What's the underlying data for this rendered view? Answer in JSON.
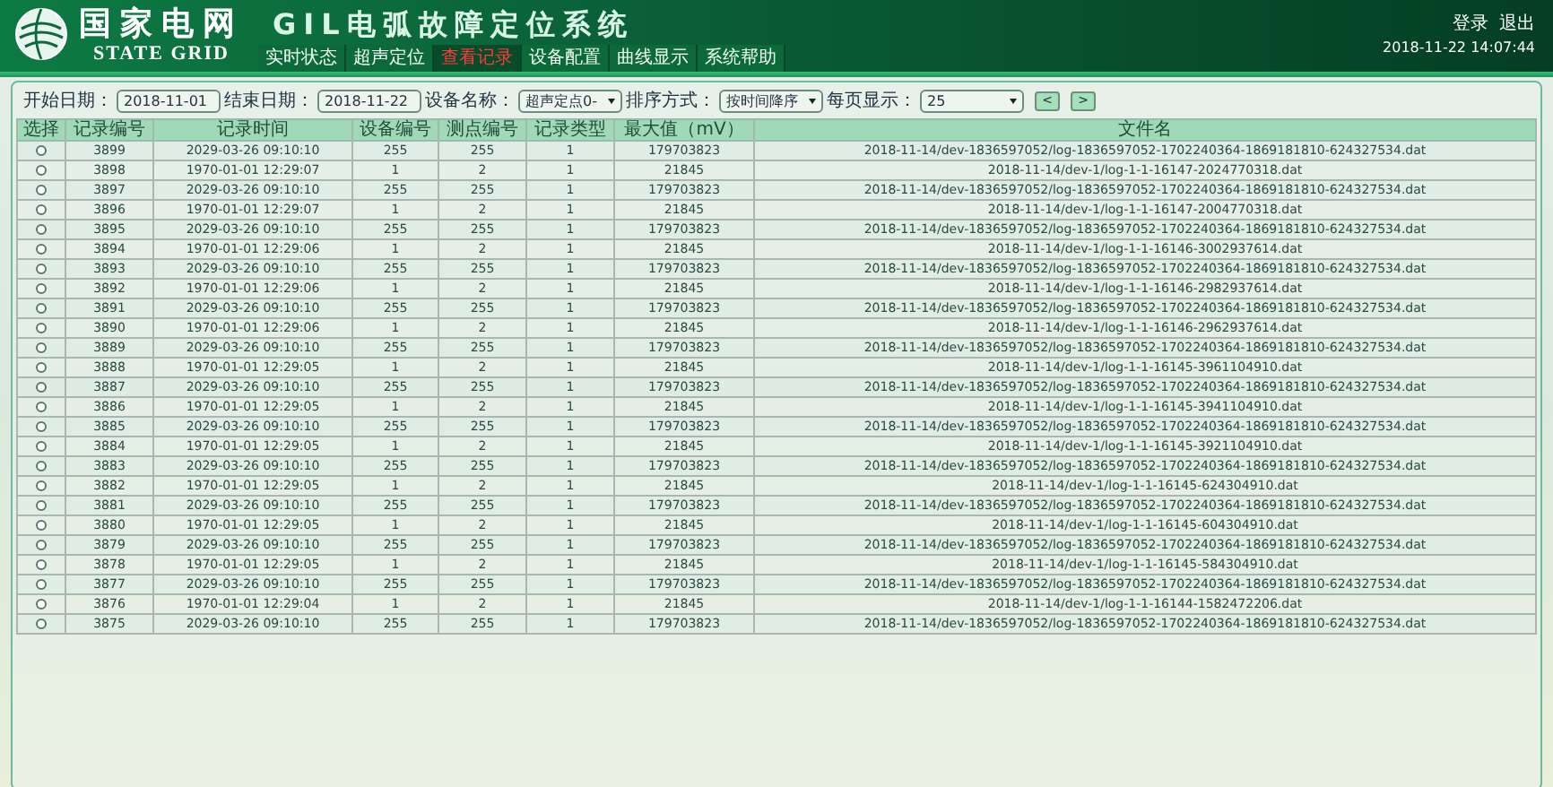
{
  "header": {
    "logo_cn": "国家电网",
    "logo_en": "STATE GRID",
    "title": "GIL电弧故障定位系统",
    "user_links": [
      "登录",
      "退出"
    ],
    "datetime": "2018-11-22 14:07:44"
  },
  "nav": [
    {
      "label": "实时状态",
      "selected": false
    },
    {
      "label": "超声定位",
      "selected": false
    },
    {
      "label": "查看记录",
      "selected": true
    },
    {
      "label": "设备配置",
      "selected": false
    },
    {
      "label": "曲线显示",
      "selected": false
    },
    {
      "label": "系统帮助",
      "selected": false
    }
  ],
  "filters": [
    {
      "kind": "input",
      "label": "开始日期：",
      "value": "2018-11-01"
    },
    {
      "kind": "input",
      "label": "结束日期：",
      "value": "2018-11-22"
    },
    {
      "kind": "select",
      "label": "设备名称：",
      "value": "超声定点0-"
    },
    {
      "kind": "select",
      "label": "排序方式：",
      "value": "按时间降序"
    },
    {
      "kind": "select",
      "label": "每页显示：",
      "value": "25"
    }
  ],
  "pager_buttons": [
    "<",
    ">"
  ],
  "table": {
    "columns": [
      "选择",
      "记录编号",
      "记录时间",
      "设备编号",
      "测点编号",
      "记录类型",
      "最大值（mV）",
      "文件名"
    ],
    "rows": [
      {
        "selected": false,
        "record_no": "3899",
        "record_time": "2029-03-26 09:10:10",
        "device_no": "255",
        "point_no": "255",
        "record_type": "1",
        "max_value": "179703823",
        "file_name": "2018-11-14/dev-1836597052/log-1836597052-1702240364-1869181810-624327534.dat"
      },
      {
        "selected": false,
        "record_no": "3898",
        "record_time": "1970-01-01 12:29:07",
        "device_no": "1",
        "point_no": "2",
        "record_type": "1",
        "max_value": "21845",
        "file_name": "2018-11-14/dev-1/log-1-1-16147-2024770318.dat"
      },
      {
        "selected": false,
        "record_no": "3897",
        "record_time": "2029-03-26 09:10:10",
        "device_no": "255",
        "point_no": "255",
        "record_type": "1",
        "max_value": "179703823",
        "file_name": "2018-11-14/dev-1836597052/log-1836597052-1702240364-1869181810-624327534.dat"
      },
      {
        "selected": false,
        "record_no": "3896",
        "record_time": "1970-01-01 12:29:07",
        "device_no": "1",
        "point_no": "2",
        "record_type": "1",
        "max_value": "21845",
        "file_name": "2018-11-14/dev-1/log-1-1-16147-2004770318.dat"
      },
      {
        "selected": false,
        "record_no": "3895",
        "record_time": "2029-03-26 09:10:10",
        "device_no": "255",
        "point_no": "255",
        "record_type": "1",
        "max_value": "179703823",
        "file_name": "2018-11-14/dev-1836597052/log-1836597052-1702240364-1869181810-624327534.dat"
      },
      {
        "selected": false,
        "record_no": "3894",
        "record_time": "1970-01-01 12:29:06",
        "device_no": "1",
        "point_no": "2",
        "record_type": "1",
        "max_value": "21845",
        "file_name": "2018-11-14/dev-1/log-1-1-16146-3002937614.dat"
      },
      {
        "selected": false,
        "record_no": "3893",
        "record_time": "2029-03-26 09:10:10",
        "device_no": "255",
        "point_no": "255",
        "record_type": "1",
        "max_value": "179703823",
        "file_name": "2018-11-14/dev-1836597052/log-1836597052-1702240364-1869181810-624327534.dat"
      },
      {
        "selected": false,
        "record_no": "3892",
        "record_time": "1970-01-01 12:29:06",
        "device_no": "1",
        "point_no": "2",
        "record_type": "1",
        "max_value": "21845",
        "file_name": "2018-11-14/dev-1/log-1-1-16146-2982937614.dat"
      },
      {
        "selected": false,
        "record_no": "3891",
        "record_time": "2029-03-26 09:10:10",
        "device_no": "255",
        "point_no": "255",
        "record_type": "1",
        "max_value": "179703823",
        "file_name": "2018-11-14/dev-1836597052/log-1836597052-1702240364-1869181810-624327534.dat"
      },
      {
        "selected": false,
        "record_no": "3890",
        "record_time": "1970-01-01 12:29:06",
        "device_no": "1",
        "point_no": "2",
        "record_type": "1",
        "max_value": "21845",
        "file_name": "2018-11-14/dev-1/log-1-1-16146-2962937614.dat"
      },
      {
        "selected": false,
        "record_no": "3889",
        "record_time": "2029-03-26 09:10:10",
        "device_no": "255",
        "point_no": "255",
        "record_type": "1",
        "max_value": "179703823",
        "file_name": "2018-11-14/dev-1836597052/log-1836597052-1702240364-1869181810-624327534.dat"
      },
      {
        "selected": false,
        "record_no": "3888",
        "record_time": "1970-01-01 12:29:05",
        "device_no": "1",
        "point_no": "2",
        "record_type": "1",
        "max_value": "21845",
        "file_name": "2018-11-14/dev-1/log-1-1-16145-3961104910.dat"
      },
      {
        "selected": false,
        "record_no": "3887",
        "record_time": "2029-03-26 09:10:10",
        "device_no": "255",
        "point_no": "255",
        "record_type": "1",
        "max_value": "179703823",
        "file_name": "2018-11-14/dev-1836597052/log-1836597052-1702240364-1869181810-624327534.dat"
      },
      {
        "selected": false,
        "record_no": "3886",
        "record_time": "1970-01-01 12:29:05",
        "device_no": "1",
        "point_no": "2",
        "record_type": "1",
        "max_value": "21845",
        "file_name": "2018-11-14/dev-1/log-1-1-16145-3941104910.dat"
      },
      {
        "selected": false,
        "record_no": "3885",
        "record_time": "2029-03-26 09:10:10",
        "device_no": "255",
        "point_no": "255",
        "record_type": "1",
        "max_value": "179703823",
        "file_name": "2018-11-14/dev-1836597052/log-1836597052-1702240364-1869181810-624327534.dat"
      },
      {
        "selected": false,
        "record_no": "3884",
        "record_time": "1970-01-01 12:29:05",
        "device_no": "1",
        "point_no": "2",
        "record_type": "1",
        "max_value": "21845",
        "file_name": "2018-11-14/dev-1/log-1-1-16145-3921104910.dat"
      },
      {
        "selected": false,
        "record_no": "3883",
        "record_time": "2029-03-26 09:10:10",
        "device_no": "255",
        "point_no": "255",
        "record_type": "1",
        "max_value": "179703823",
        "file_name": "2018-11-14/dev-1836597052/log-1836597052-1702240364-1869181810-624327534.dat"
      },
      {
        "selected": false,
        "record_no": "3882",
        "record_time": "1970-01-01 12:29:05",
        "device_no": "1",
        "point_no": "2",
        "record_type": "1",
        "max_value": "21845",
        "file_name": "2018-11-14/dev-1/log-1-1-16145-624304910.dat"
      },
      {
        "selected": false,
        "record_no": "3881",
        "record_time": "2029-03-26 09:10:10",
        "device_no": "255",
        "point_no": "255",
        "record_type": "1",
        "max_value": "179703823",
        "file_name": "2018-11-14/dev-1836597052/log-1836597052-1702240364-1869181810-624327534.dat"
      },
      {
        "selected": false,
        "record_no": "3880",
        "record_time": "1970-01-01 12:29:05",
        "device_no": "1",
        "point_no": "2",
        "record_type": "1",
        "max_value": "21845",
        "file_name": "2018-11-14/dev-1/log-1-1-16145-604304910.dat"
      },
      {
        "selected": false,
        "record_no": "3879",
        "record_time": "2029-03-26 09:10:10",
        "device_no": "255",
        "point_no": "255",
        "record_type": "1",
        "max_value": "179703823",
        "file_name": "2018-11-14/dev-1836597052/log-1836597052-1702240364-1869181810-624327534.dat"
      },
      {
        "selected": false,
        "record_no": "3878",
        "record_time": "1970-01-01 12:29:05",
        "device_no": "1",
        "point_no": "2",
        "record_type": "1",
        "max_value": "21845",
        "file_name": "2018-11-14/dev-1/log-1-1-16145-584304910.dat"
      },
      {
        "selected": false,
        "record_no": "3877",
        "record_time": "2029-03-26 09:10:10",
        "device_no": "255",
        "point_no": "255",
        "record_type": "1",
        "max_value": "179703823",
        "file_name": "2018-11-14/dev-1836597052/log-1836597052-1702240364-1869181810-624327534.dat"
      },
      {
        "selected": false,
        "record_no": "3876",
        "record_time": "1970-01-01 12:29:04",
        "device_no": "1",
        "point_no": "2",
        "record_type": "1",
        "max_value": "21845",
        "file_name": "2018-11-14/dev-1/log-1-1-16144-1582472206.dat"
      },
      {
        "selected": false,
        "record_no": "3875",
        "record_time": "2029-03-26 09:10:10",
        "device_no": "255",
        "point_no": "255",
        "record_type": "1",
        "max_value": "179703823",
        "file_name": "2018-11-14/dev-1836597052/log-1836597052-1702240364-1869181810-624327534.dat"
      }
    ]
  }
}
